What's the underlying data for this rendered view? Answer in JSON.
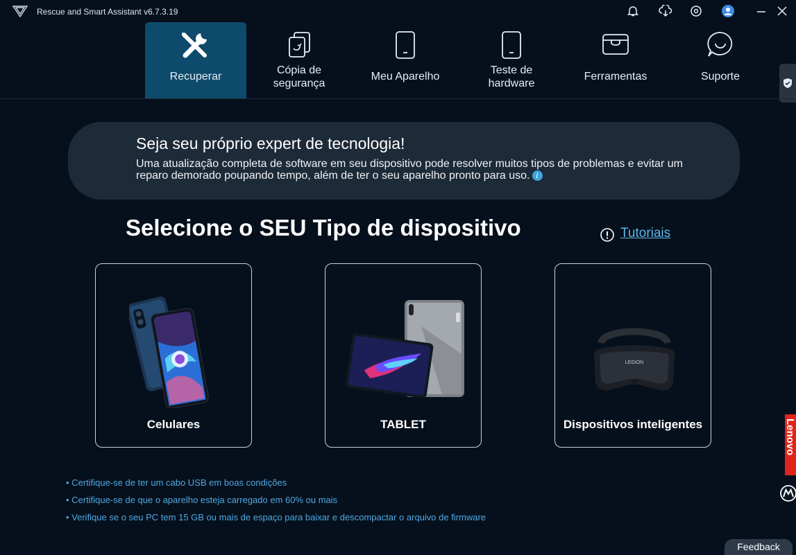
{
  "app": {
    "title": "Rescue and Smart Assistant v6.7.3.19"
  },
  "titlebar_icons": [
    "bell-icon",
    "cloud-download-icon",
    "settings-circle-icon",
    "user-avatar-icon",
    "minimize-icon",
    "close-icon"
  ],
  "nav": {
    "tabs": [
      {
        "label": "Recuperar",
        "icon": "wrench-screwdriver-icon",
        "active": true
      },
      {
        "label_line1": "Cópia de",
        "label_line2": "segurança",
        "icon": "backup-copy-icon"
      },
      {
        "label": "Meu Aparelho",
        "icon": "phone-icon"
      },
      {
        "label_line1": "Teste de",
        "label_line2": "hardware",
        "icon": "phone-test-icon"
      },
      {
        "label": "Ferramentas",
        "icon": "toolbox-icon"
      },
      {
        "label": "Suporte",
        "icon": "chat-support-icon"
      }
    ]
  },
  "banner": {
    "title": "Seja seu próprio expert de tecnologia!",
    "text": "Uma atualização completa de software em seu dispositivo pode resolver muitos tipos de problemas e evitar um reparo demorado poupando tempo, além de ter o seu aparelho pronto para uso."
  },
  "main": {
    "heading": "Selecione o SEU Tipo de dispositivo",
    "tutorials_link": "Tutoriais",
    "cards": [
      {
        "label": "Celulares",
        "image": "smartphones-image"
      },
      {
        "label": "TABLET",
        "image": "tablet-image"
      },
      {
        "label": "Dispositivos inteligentes",
        "image": "vr-headset-image",
        "brand_text": "LEGION"
      }
    ]
  },
  "tips": [
    "Certifique-se de ter um cabo USB em boas condições",
    "Certifique-se de que o aparelho esteja carregado em 60% ou mais",
    "Verifique se o seu PC tem 15 GB ou mais de espaço para baixar e descompactar o arquivo de firmware"
  ],
  "feedback_label": "Feedback",
  "side": {
    "lenovo_label": "Lenovo"
  },
  "colors": {
    "background": "#06101c",
    "accent_tab": "#0e4a6b",
    "link": "#5bb8ea",
    "banner": "#1d2a38",
    "lenovo_red": "#e2231a"
  }
}
